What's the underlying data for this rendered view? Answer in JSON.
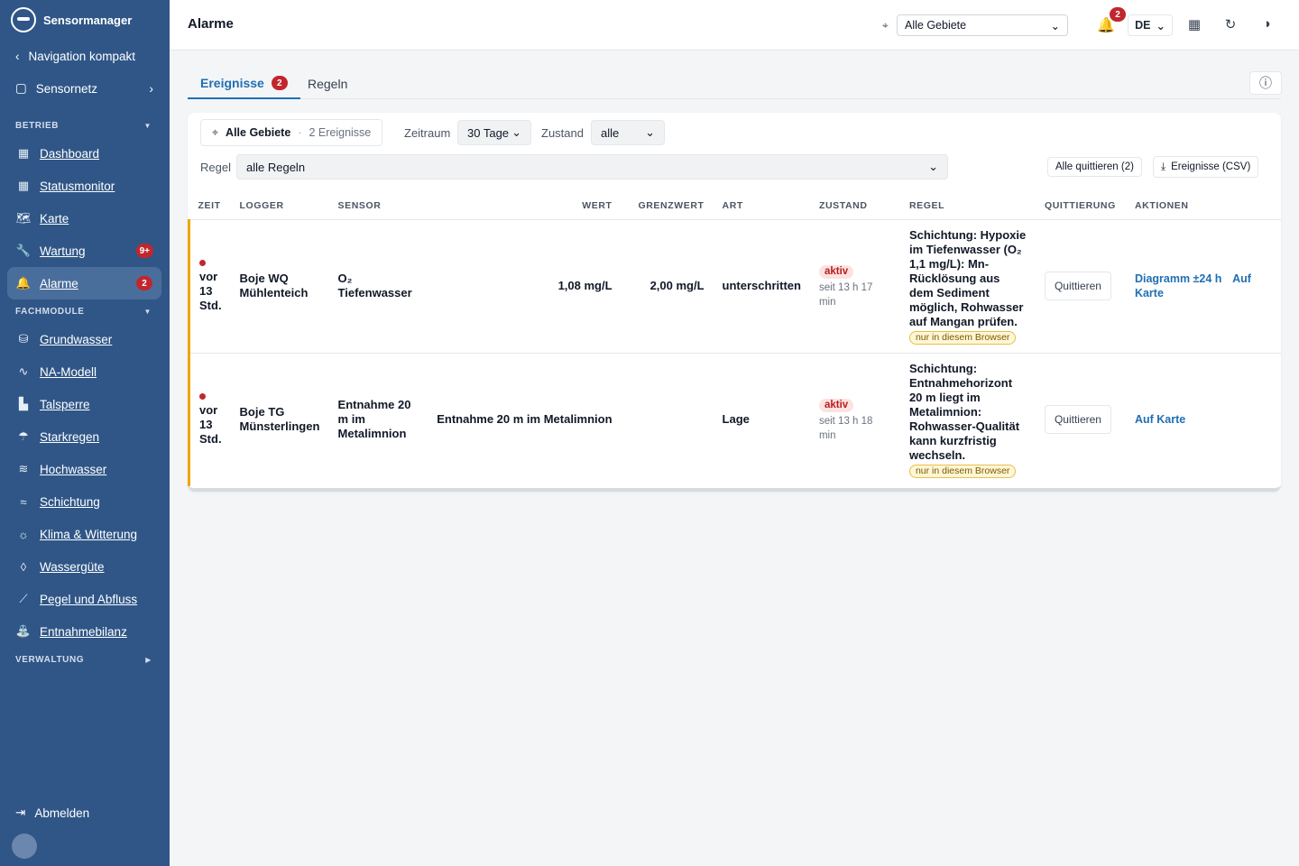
{
  "app": {
    "name": "Sensormanager"
  },
  "sidebar": {
    "compact_label": "Navigation kompakt",
    "sensornetz_label": "Sensornetz",
    "sections": {
      "betrieb": "BETRIEB",
      "fachmodule": "FACHMODULE",
      "verwaltung": "VERWALTUNG"
    },
    "betrieb_items": [
      {
        "label": "Dashboard",
        "icon": "grid-icon"
      },
      {
        "label": "Statusmonitor",
        "icon": "grid-icon"
      },
      {
        "label": "Karte",
        "icon": "map-icon"
      },
      {
        "label": "Wartung",
        "icon": "wrench-icon",
        "badge": "9+"
      },
      {
        "label": "Alarme",
        "icon": "bell-icon",
        "badge": "2",
        "active": true
      }
    ],
    "fachmodule_items": [
      {
        "label": "Grundwasser"
      },
      {
        "label": "NA-Modell"
      },
      {
        "label": "Talsperre"
      },
      {
        "label": "Starkregen"
      },
      {
        "label": "Hochwasser"
      },
      {
        "label": "Schichtung"
      },
      {
        "label": "Klima & Witterung"
      },
      {
        "label": "Wassergüte"
      },
      {
        "label": "Pegel und Abfluss"
      },
      {
        "label": "Entnahmebilanz"
      }
    ],
    "logout_label": "Abmelden"
  },
  "topbar": {
    "title": "Alarme",
    "area_select": "Alle Gebiete",
    "notifications_count": "2",
    "language": "DE"
  },
  "tabs": [
    {
      "label": "Ereignisse",
      "count": "2"
    },
    {
      "label": "Regeln"
    }
  ],
  "filters": {
    "area_chip_title": "Alle Gebiete",
    "area_chip_sep": "·",
    "area_chip_count": "2 Ereignisse",
    "period_label": "Zeitraum",
    "period_value": "30 Tage",
    "state_label": "Zustand",
    "state_value": "alle",
    "rule_label": "Regel",
    "rule_value": "alle Regeln",
    "ack_all": "Alle quittieren (2)",
    "export_csv": "Ereignisse (CSV)"
  },
  "table": {
    "headers": {
      "time": "ZEIT",
      "logger": "LOGGER",
      "sensor": "SENSOR",
      "value": "WERT",
      "limit": "GRENZWERT",
      "kind": "ART",
      "state": "ZUSTAND",
      "rule": "REGEL",
      "ack": "QUITTIERUNG",
      "actions": "AKTIONEN"
    },
    "rows": [
      {
        "time": "vor 13 Std.",
        "logger": "Boje WQ Mühlenteich",
        "sensor": "O₂ Tiefenwasser",
        "value": "1,08 mg/L",
        "limit": "2,00 mg/L",
        "kind": "unterschritten",
        "state": "aktiv",
        "since": "seit 13 h 17 min",
        "rule": "Schichtung: Hypoxie im Tiefenwasser (O₂ 1,1 mg/L): Mn-Rücklösung aus dem Sediment möglich, Rohwasser auf Mangan prüfen.",
        "local_badge": "nur in diesem Browser",
        "ack": "Quittieren",
        "action_diagram": "Diagramm ±24 h",
        "action_map": "Auf Karte"
      },
      {
        "time": "vor 13 Std.",
        "logger": "Boje TG Münsterlingen",
        "sensor": "Entnahme 20 m im Metalimnion",
        "value": "Entnahme 20 m im Metalimnion",
        "limit": "",
        "kind": "Lage",
        "state": "aktiv",
        "since": "seit 13 h 18 min",
        "rule": "Schichtung: Entnahmehorizont 20 m liegt im Metalimnion: Rohwasser-Qualität kann kurzfristig wechseln.",
        "local_badge": "nur in diesem Browser",
        "ack": "Quittieren",
        "action_map": "Auf Karte"
      }
    ]
  }
}
